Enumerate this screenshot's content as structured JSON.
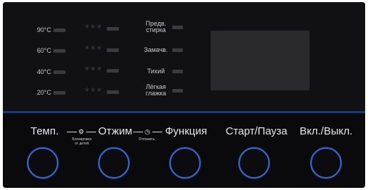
{
  "temperatures": [
    "90°C",
    "60°C",
    "40°C",
    "20°C"
  ],
  "spin_stars": "***",
  "options": [
    {
      "line1": "Предв.",
      "line2": "стирка"
    },
    {
      "line1": "Замачв.",
      "line2": ""
    },
    {
      "line1": "Тихий",
      "line2": ""
    },
    {
      "line1": "Лёгкая",
      "line2": "глажка"
    }
  ],
  "buttons": {
    "temp": "Темп.",
    "spin": "Отжим",
    "function": "Функция",
    "start": "Старт/Пауза",
    "power": "Вкл./Выкл."
  },
  "child_lock": {
    "line1": "Блокировка",
    "line2": "от детей"
  },
  "delay": "Отложить",
  "dash": "—",
  "lock_symbol": "⚙",
  "clock_symbol": "◷"
}
